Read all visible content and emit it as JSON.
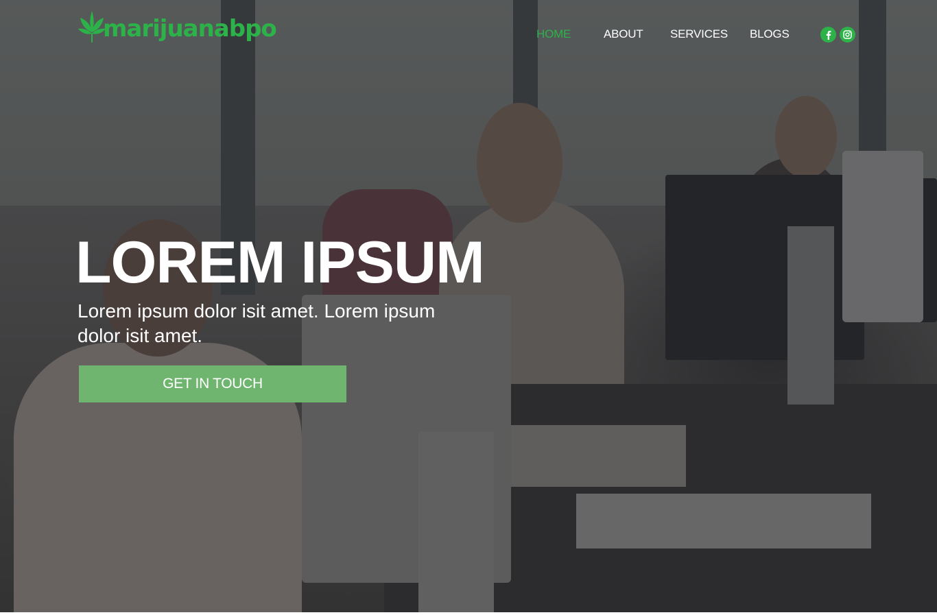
{
  "brand": {
    "logo_text": "marijuanabpo",
    "logo_icon": "cannabis-leaf-icon",
    "accent_color": "#2db24a"
  },
  "nav": {
    "items": [
      {
        "label": "HOME",
        "active": true
      },
      {
        "label": "ABOUT",
        "active": false
      },
      {
        "label": "SERVICES",
        "active": false
      },
      {
        "label": "BLOGS",
        "active": false
      }
    ],
    "social": [
      {
        "icon": "facebook-icon"
      },
      {
        "icon": "instagram-icon"
      }
    ]
  },
  "hero": {
    "headline": "LOREM IPSUM",
    "subtext": "Lorem ipsum dolor isit amet. Lorem ipsum dolor isit amet.",
    "cta_label": "GET IN TOUCH",
    "cta_color": "#6fb56f"
  }
}
